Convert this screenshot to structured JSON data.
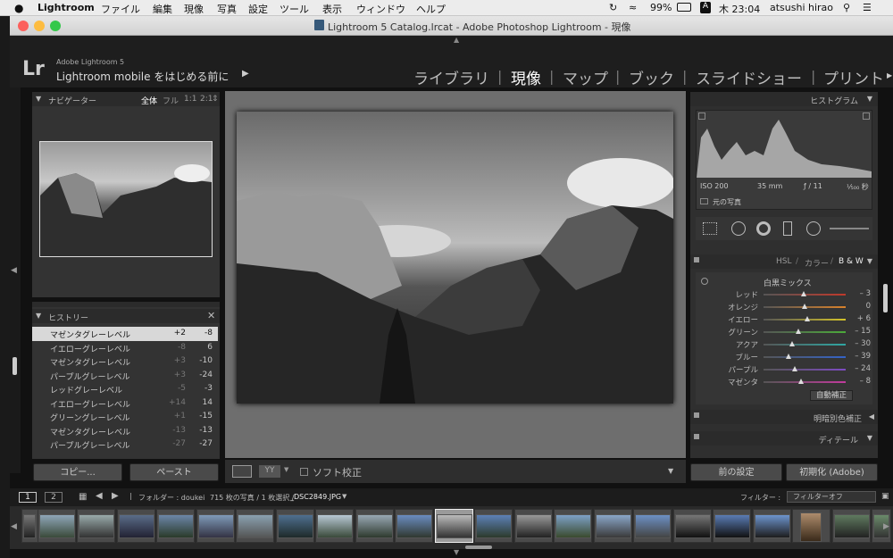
{
  "menubar": {
    "app": "Lightroom",
    "items": [
      "ファイル",
      "編集",
      "現像",
      "写真",
      "設定",
      "ツール",
      "表示",
      "ウィンドウ",
      "ヘルプ"
    ],
    "battery": "99%",
    "input": "A",
    "clock": "木 23:04",
    "user": "atsushi hirao"
  },
  "window": {
    "title": "Lightroom 5 Catalog.lrcat - Adobe Photoshop Lightroom - 現像"
  },
  "identity": {
    "logo": "Lr",
    "brand": "Adobe Lightroom 5",
    "mobile": "Lightroom mobile をはじめる前に"
  },
  "modules": [
    "ライブラリ",
    "現像",
    "マップ",
    "ブック",
    "スライドショー",
    "プリント"
  ],
  "navigator": {
    "title": "ナビゲーター",
    "zooms": [
      "全体",
      "フル",
      "1:1",
      "2:1"
    ]
  },
  "history": {
    "title": "ヒストリー",
    "items": [
      {
        "label": "マゼンタグレーレベル",
        "delta": "+2",
        "value": "-8"
      },
      {
        "label": "イエローグレーレベル",
        "delta": "-8",
        "value": "6"
      },
      {
        "label": "マゼンタグレーレベル",
        "delta": "+3",
        "value": "-10"
      },
      {
        "label": "パープルグレーレベル",
        "delta": "+3",
        "value": "-24"
      },
      {
        "label": "レッドグレーレベル",
        "delta": "-5",
        "value": "-3"
      },
      {
        "label": "イエローグレーレベル",
        "delta": "+14",
        "value": "14"
      },
      {
        "label": "グリーングレーレベル",
        "delta": "+1",
        "value": "-15"
      },
      {
        "label": "マゼンタグレーレベル",
        "delta": "-13",
        "value": "-13"
      },
      {
        "label": "パープルグレーレベル",
        "delta": "-27",
        "value": "-27"
      }
    ]
  },
  "leftButtons": {
    "copy": "コピー...",
    "paste": "ペースト"
  },
  "histogram": {
    "title": "ヒストグラム",
    "iso": "ISO 200",
    "focal": "35 mm",
    "aperture": "ƒ / 11",
    "shutter": "¹⁄₅₀₀ 秒",
    "original": "元の写真"
  },
  "hsl": {
    "tabs": [
      "HSL",
      "カラー",
      "B & W"
    ],
    "section": "白黒ミックス",
    "sliders": [
      {
        "label": "レッド",
        "value": "– 3",
        "num": -3,
        "color": "#c0392b"
      },
      {
        "label": "オレンジ",
        "value": "0",
        "num": 0,
        "color": "#d9822b"
      },
      {
        "label": "イエロー",
        "value": "+ 6",
        "num": 6,
        "color": "#d4c32a"
      },
      {
        "label": "グリーン",
        "value": "– 15",
        "num": -15,
        "color": "#4caa3a"
      },
      {
        "label": "アクア",
        "value": "– 30",
        "num": -30,
        "color": "#2fa7a3"
      },
      {
        "label": "ブルー",
        "value": "– 39",
        "num": -39,
        "color": "#3463c8"
      },
      {
        "label": "パープル",
        "value": "– 24",
        "num": -24,
        "color": "#7d4bc3"
      },
      {
        "label": "マゼンタ",
        "value": "– 8",
        "num": -8,
        "color": "#c23b9d"
      }
    ],
    "auto": "自動補正"
  },
  "split": {
    "title": "明暗別色補正"
  },
  "detail": {
    "title": "ディテール"
  },
  "rightButtons": {
    "prev": "前の設定",
    "reset": "初期化 (Adobe)"
  },
  "toolbar": {
    "softproof": "ソフト校正"
  },
  "filmbar": {
    "page1": "1",
    "page2": "2",
    "folder": "フォルダー : doukei",
    "count": "715 枚の写真 / 1 枚選択 /",
    "file": "_DSC2849.JPG",
    "filterLabel": "フィルター :",
    "filterValue": "フィルターオフ"
  },
  "colors": {
    "accent": "#cfcfcf",
    "panel": "#333333"
  }
}
